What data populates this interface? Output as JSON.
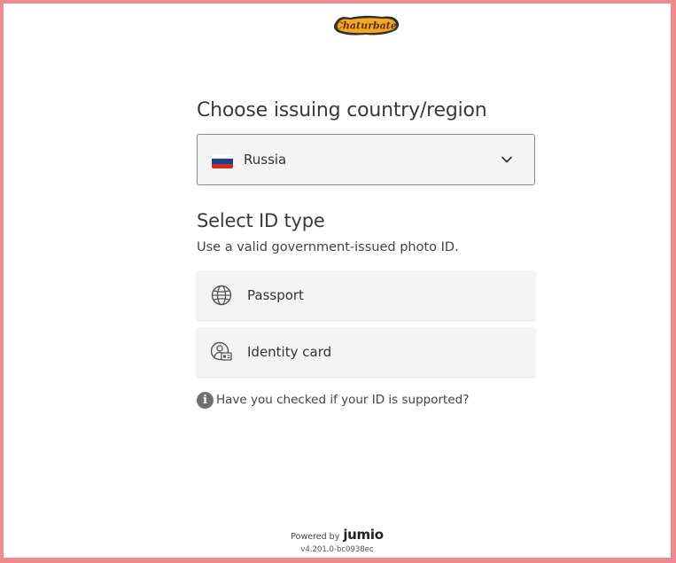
{
  "brand": {
    "logo_text": "Chaturbate"
  },
  "country_section": {
    "heading": "Choose issuing country/region",
    "selected_country": "Russia",
    "flag_colors": [
      "#ffffff",
      "#1c3f94",
      "#d52b1e"
    ]
  },
  "id_section": {
    "heading": "Select ID type",
    "subtitle": "Use a valid government-issued photo ID.",
    "options": [
      {
        "label": "Passport",
        "icon": "globe-icon"
      },
      {
        "label": "Identity card",
        "icon": "id-card-icon"
      }
    ]
  },
  "help": {
    "text": "Have you checked if your ID is supported?",
    "icon": "info-icon"
  },
  "footer": {
    "powered_by": "Powered by",
    "brand": "jumio",
    "version": "v4.201.0-bc0938ec"
  },
  "colors": {
    "border": "#ee8a8f",
    "option_bg": "#f4f4f4",
    "logo_orange": "#f5a623"
  }
}
